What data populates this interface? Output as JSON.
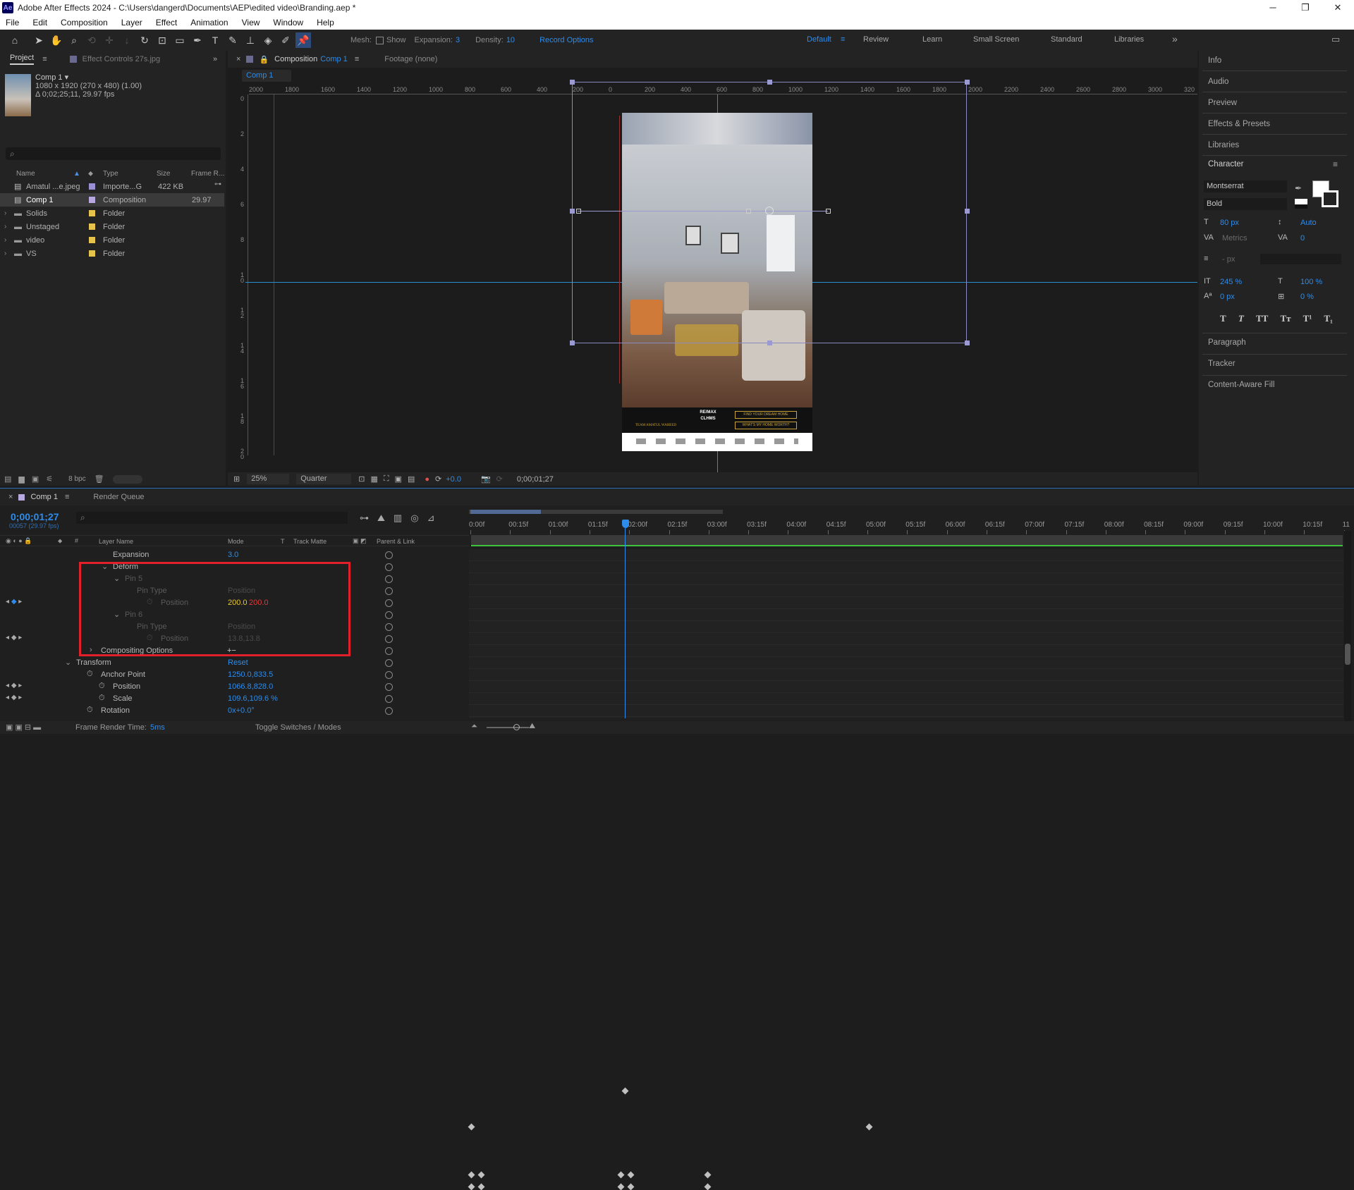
{
  "window": {
    "title": "Adobe After Effects 2024 - C:\\Users\\dangerd\\Documents\\AEP\\edited video\\Branding.aep *",
    "logo": "Ae",
    "minimize": "─",
    "maximize": "❐",
    "close": "✕"
  },
  "menu": [
    "File",
    "Edit",
    "Composition",
    "Layer",
    "Effect",
    "Animation",
    "View",
    "Window",
    "Help"
  ],
  "toolbar": {
    "mesh_label": "Mesh:",
    "show_label": "Show",
    "expansion_label": "Expansion:",
    "expansion_value": "3",
    "density_label": "Density:",
    "density_value": "10",
    "record_options": "Record Options",
    "workspaces": [
      "Default",
      "Review",
      "Learn",
      "Small Screen",
      "Standard",
      "Libraries"
    ],
    "more": "»"
  },
  "project": {
    "tab": "Project",
    "tab2": "Effect Controls 27s.jpg",
    "thumb_name": "Comp 1 ▾",
    "thumb_info1": "1080 x 1920  (270 x 480) (1.00)",
    "thumb_info2": "Δ 0;02;25;11, 29.97 fps",
    "search_placeholder": "⌕",
    "bpc": "8 bpc",
    "columns": [
      "Name",
      "Type",
      "Size",
      "Frame R..."
    ],
    "items": [
      {
        "name": "Amatul ...e.jpeg",
        "type": "Importe...G",
        "size": "422 KB",
        "fr": "",
        "color": "#9b8fd4"
      },
      {
        "name": "Comp 1",
        "type": "Composition",
        "size": "",
        "fr": "29.97",
        "color": "#b7a9e0"
      },
      {
        "name": "Solids",
        "type": "Folder",
        "size": "",
        "fr": "",
        "color": "#e6c44c"
      },
      {
        "name": "Unstaged",
        "type": "Folder",
        "size": "",
        "fr": "",
        "color": "#e6c44c"
      },
      {
        "name": "video",
        "type": "Folder",
        "size": "",
        "fr": "",
        "color": "#e6c44c"
      },
      {
        "name": "VS",
        "type": "Folder",
        "size": "",
        "fr": "",
        "color": "#e6c44c"
      }
    ]
  },
  "composition": {
    "tab_label": "Composition",
    "tab_comp": "Comp 1",
    "footage": "Footage (none)",
    "breadcrumb": "Comp 1",
    "zoom": "25%",
    "resolution": "Quarter",
    "exposure": "+0.0",
    "timecode": "0;00;01;27",
    "ruler_top": [
      "2000",
      "1800",
      "1600",
      "1400",
      "1200",
      "1000",
      "800",
      "600",
      "400",
      "200",
      "0",
      "200",
      "400",
      "600",
      "800",
      "1000",
      "1200",
      "1400",
      "1600",
      "1800",
      "2000",
      "2200",
      "2400",
      "2600",
      "2800",
      "3000",
      "320"
    ],
    "ruler_left": [
      "0",
      "2",
      "4",
      "6",
      "8",
      "1 0",
      "1 2",
      "1 4",
      "1 6",
      "1 8",
      "2 0"
    ],
    "banner": {
      "left": "TEAM AMATUL WAHEED",
      "mid": "RE/MAX CLHMS",
      "btn1": "FIND YOUR DREAM HOME",
      "btn2": "WHAT'S MY HOME WORTH?"
    }
  },
  "right_panel": {
    "items": [
      "Info",
      "Audio",
      "Preview",
      "Effects & Presets",
      "Libraries"
    ],
    "character": "Character",
    "font": "Montserrat",
    "style": "Bold",
    "size": "80 px",
    "leading": "Auto",
    "kerning": "Metrics",
    "tracking": "0",
    "stroke": "- px",
    "vscale": "245 %",
    "hscale": "100 %",
    "baseline": "0 px",
    "tsume": "0 %",
    "type_buttons": [
      "T",
      "T",
      "TT",
      "Tт",
      "T¹",
      "T₁"
    ],
    "bottom_items": [
      "Paragraph",
      "Tracker",
      "Content-Aware Fill"
    ]
  },
  "timeline": {
    "tab": "Comp 1",
    "render_queue": "Render Queue",
    "timecode": "0;00;01;27",
    "frames": "00057 (29.97 fps)",
    "columns": [
      "Layer Name",
      "Mode",
      "T",
      "Track Matte",
      "Parent & Link"
    ],
    "ticks": [
      "0:00f",
      "00:15f",
      "01:00f",
      "01:15f",
      "02:00f",
      "02:15f",
      "03:00f",
      "03:15f",
      "04:00f",
      "04:15f",
      "05:00f",
      "05:15f",
      "06:00f",
      "06:15f",
      "07:00f",
      "07:15f",
      "08:00f",
      "08:15f",
      "09:00f",
      "09:15f",
      "10:00f",
      "10:15f",
      "11"
    ],
    "rows": [
      {
        "label": "Expansion",
        "value": "3.0",
        "indent": 160
      },
      {
        "label": "Deform",
        "value": "",
        "indent": 160,
        "twirl": "⌄"
      },
      {
        "label": "Pin 5",
        "value": "",
        "indent": 177,
        "twirl": "⌄",
        "dim": true
      },
      {
        "label": "Pin Type",
        "value": "Position",
        "indent": 194,
        "dim": true
      },
      {
        "label": "Position",
        "value_a": "200.0",
        "value_b": "200.0",
        "indent": 228,
        "dim": true
      },
      {
        "label": "Pin 6",
        "value": "",
        "indent": 177,
        "twirl": "⌄",
        "dim": true
      },
      {
        "label": "Pin Type",
        "value": "Position",
        "indent": 194,
        "dim": true
      },
      {
        "label": "Position",
        "value": "13.8,13.8",
        "indent": 228,
        "dim": true
      },
      {
        "label": "Compositing Options",
        "value": "+−",
        "indent": 143,
        "twirl": "›"
      },
      {
        "label": "Transform",
        "value": "Reset",
        "indent": 108,
        "twirl": "⌄"
      },
      {
        "label": "Anchor Point",
        "value": "1250.0,833.5",
        "indent": 143
      },
      {
        "label": "Position",
        "value": "1066.8,828.0",
        "indent": 160
      },
      {
        "label": "Scale",
        "value": "109.6,109.6 %",
        "indent": 160
      },
      {
        "label": "Rotation",
        "value": "0x+0.0°",
        "indent": 143
      }
    ],
    "render_time_label": "Frame Render Time:",
    "render_time": "5ms",
    "toggle": "Toggle Switches / Modes"
  }
}
